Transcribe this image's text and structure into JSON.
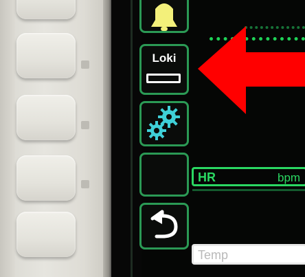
{
  "softkeys": {
    "lock_label": "Loki"
  },
  "parameters": {
    "hr": {
      "name": "HR",
      "unit": "bpm"
    },
    "temp": {
      "name": "Temp"
    }
  },
  "colors": {
    "accent_green": "#2ad862",
    "annotation_red": "#ff0000",
    "alarm_yellow": "#f3f07a",
    "gear_cyan": "#3fd0d8"
  },
  "icons": [
    "alarm-bell-icon",
    "lock-icon",
    "gear-icon",
    "back-arrow-icon",
    "annotation-arrow"
  ]
}
